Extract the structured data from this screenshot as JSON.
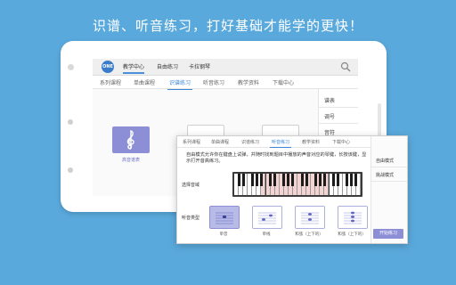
{
  "headline": "识谱、听音练习，打好基础才能学的更快！",
  "back_app": {
    "logo_text": "ONE",
    "top_tabs": [
      "教学中心",
      "自由练习",
      "卡拉钢琴"
    ],
    "sub_tabs": [
      "系列课程",
      "单曲课程",
      "识谱练习",
      "听音练习",
      "教学资料",
      "下载中心"
    ],
    "active_sub_tab": "识谱练习",
    "right_list": [
      "谱表",
      "调号",
      "音符"
    ],
    "card_label": "高音谱表"
  },
  "panel": {
    "tabs": [
      "系列课程",
      "单曲课程",
      "识谱练习",
      "听音练习",
      "教学资料",
      "下载中心"
    ],
    "active_tab": "听音练习",
    "side_items": [
      "自由模式",
      "挑战模式"
    ],
    "description": "自由模式允许你在键盘上试弹，并随时找到题目中播放的声音对应的琴键，长按该键，显示打开音高练习。",
    "range_label": "选择音域",
    "type_label": "听音类型",
    "types": [
      "单音",
      "单线",
      "和弦（上下的）",
      "和弦（上下的）"
    ],
    "start_button": "开始练习"
  },
  "colors": {
    "background": "#5aa9dc",
    "accent": "#8d8fd6",
    "tab_active": "#3d86d6"
  }
}
